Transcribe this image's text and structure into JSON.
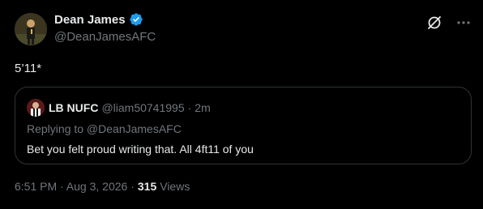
{
  "author": {
    "name": "Dean James",
    "handle": "@DeanJamesAFC"
  },
  "tweet": {
    "text": "5’11*"
  },
  "quoted": {
    "name": "LB NUFC",
    "handle": "@liam50741995",
    "separator": "·",
    "time": "2m",
    "replying_to": "Replying to @DeanJamesAFC",
    "text": "Bet you felt proud writing that. All 4ft11 of you"
  },
  "meta": {
    "timestamp": "6:51 PM · Aug 3, 2026 ·",
    "views_count": "315",
    "views_label": "Views"
  },
  "icons": {
    "verified": "verified-badge-icon",
    "grok": "slash-circle-icon",
    "more": "more-dots-icon"
  },
  "colors": {
    "verified": "#1d9bf0",
    "secondary_text": "#71767b",
    "primary_text": "#e7e9ea"
  }
}
